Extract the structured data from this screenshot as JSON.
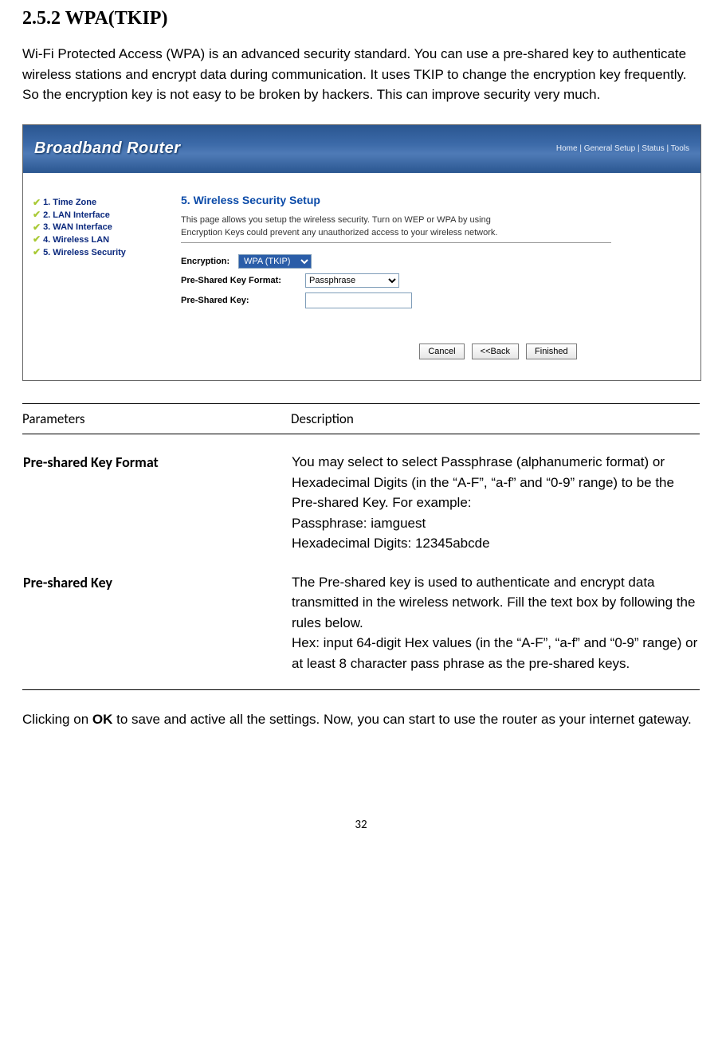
{
  "section": {
    "number": "2.5.2",
    "title_text": "WPA(TKIP)",
    "full_heading": "2.5.2 WPA(TKIP)"
  },
  "intro_paragraph": "Wi-Fi Protected Access (WPA) is an advanced security standard. You can use a pre-shared key to authenticate wireless stations and encrypt data during communication. It uses TKIP to change the encryption key frequently. So the encryption key is not easy to be broken by hackers. This can improve security very much.",
  "router": {
    "brand": "Broadband Router",
    "top_nav": "Home | General Setup | Status | Tools",
    "sidebar": {
      "items": [
        {
          "label": "1. Time Zone"
        },
        {
          "label": "2. LAN Interface"
        },
        {
          "label": "3. WAN Interface"
        },
        {
          "label": "4. Wireless LAN"
        },
        {
          "label": "5. Wireless Security"
        }
      ]
    },
    "main": {
      "heading": "5. Wireless Security Setup",
      "desc_line1": "This page allows you setup the wireless security. Turn on WEP or WPA by using",
      "desc_line2": "Encryption Keys could prevent any unauthorized access to your wireless network.",
      "fields": {
        "encryption_label": "Encryption:",
        "encryption_value": "WPA (TKIP)",
        "psk_format_label": "Pre-Shared Key Format:",
        "psk_format_value": "Passphrase",
        "psk_label": "Pre-Shared Key:",
        "psk_value": ""
      },
      "buttons": {
        "cancel": "Cancel",
        "back": "<<Back",
        "finished": "Finished"
      }
    }
  },
  "table": {
    "header_param": "Parameters",
    "header_desc": "Description",
    "rows": [
      {
        "param": "Pre-shared Key Format",
        "desc": "You may select to select Passphrase (alphanumeric format) or Hexadecimal Digits (in the “A-F”, “a-f” and “0-9” range) to be the Pre-shared Key. For example:\nPassphrase: iamguest\nHexadecimal Digits: 12345abcde"
      },
      {
        "param": "Pre-shared Key",
        "desc": "The Pre-shared key is used to authenticate and encrypt data transmitted in the wireless network. Fill the text box by following the rules below.\nHex: input 64-digit Hex values (in the “A-F”, “a-f” and “0-9” range) or at least 8 character pass phrase as the pre-shared keys."
      }
    ]
  },
  "closing": {
    "pre": "Clicking on ",
    "bold": "OK",
    "post": " to save and active all the settings. Now, you can start to use the router as your internet gateway."
  },
  "page_number": "32"
}
